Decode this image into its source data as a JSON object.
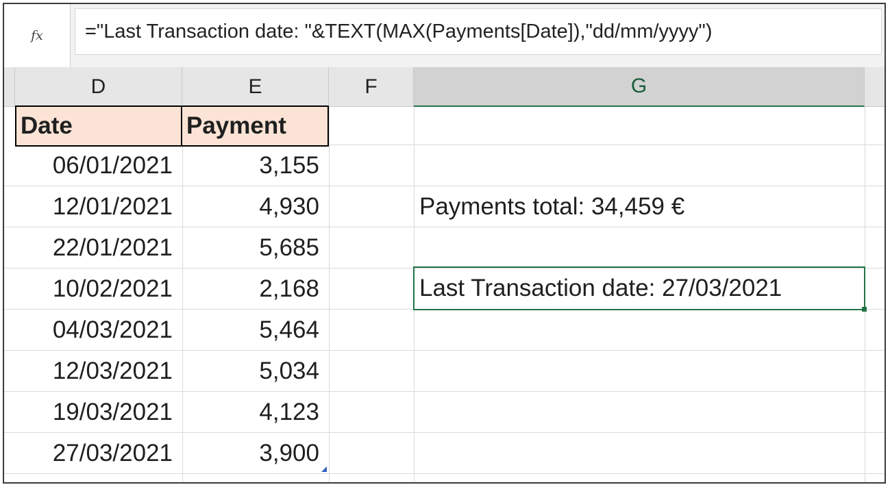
{
  "formula_bar": {
    "fx_icon": "fx-function-icon",
    "formula": "=\"Last Transaction date: \"&TEXT(MAX(Payments[Date]),\"dd/mm/yyyy\")"
  },
  "columns": [
    "D",
    "E",
    "F",
    "G"
  ],
  "selected_column": "G",
  "table": {
    "headers": [
      "Date",
      "Payment"
    ],
    "rows": [
      {
        "date": "06/01/2021",
        "payment": "3,155"
      },
      {
        "date": "12/01/2021",
        "payment": "4,930"
      },
      {
        "date": "22/01/2021",
        "payment": "5,685"
      },
      {
        "date": "10/02/2021",
        "payment": "2,168"
      },
      {
        "date": "04/03/2021",
        "payment": "5,464"
      },
      {
        "date": "12/03/2021",
        "payment": "5,034"
      },
      {
        "date": "19/03/2021",
        "payment": "4,123"
      },
      {
        "date": "27/03/2021",
        "payment": "3,900"
      }
    ]
  },
  "results": {
    "payments_total": "Payments total: 34,459 €",
    "last_transaction": "Last Transaction date: 27/03/2021"
  },
  "colors": {
    "header_fill": "#fbe4d5",
    "selection": "#217346"
  }
}
